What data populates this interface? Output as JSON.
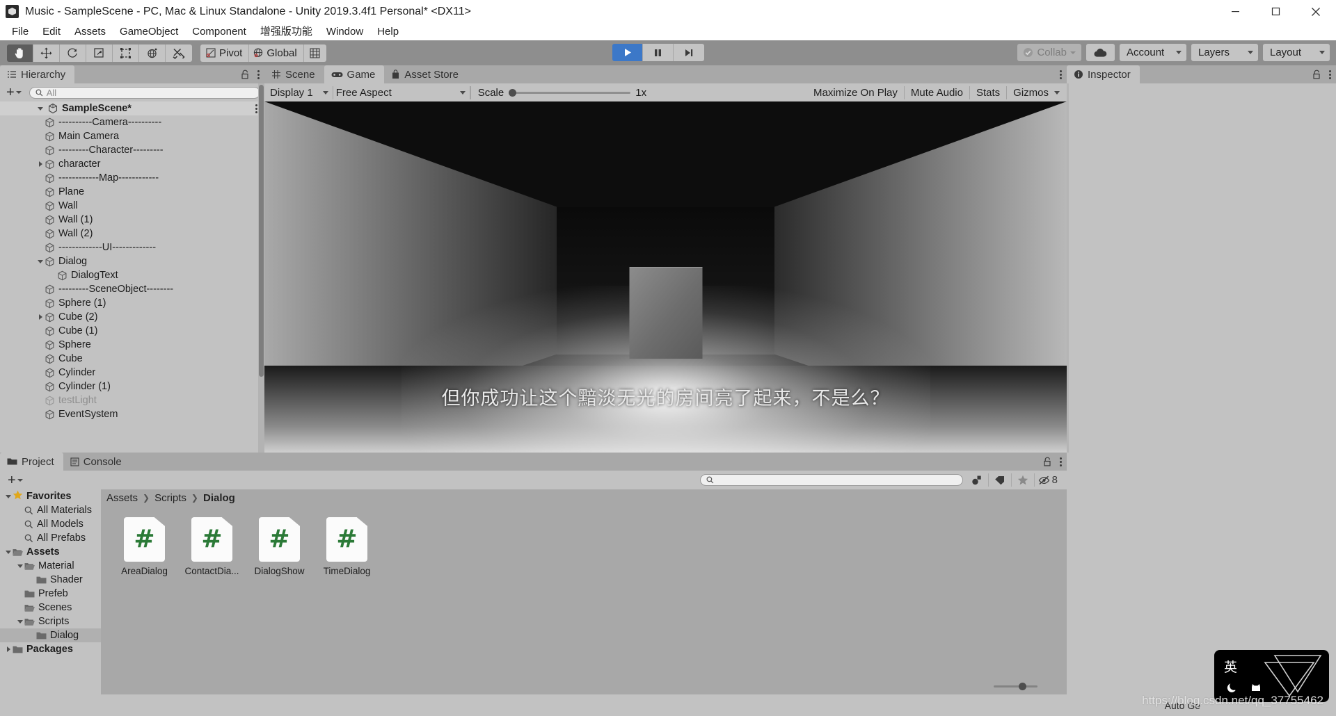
{
  "window": {
    "title": "Music - SampleScene - PC, Mac & Linux Standalone - Unity 2019.3.4f1 Personal* <DX11>",
    "logo_icon": "unity-logo-icon",
    "minimize_icon": "minimize-icon",
    "maximize_icon": "maximize-icon",
    "close_icon": "close-icon"
  },
  "menu": {
    "items": [
      {
        "label": "File"
      },
      {
        "label": "Edit"
      },
      {
        "label": "Assets"
      },
      {
        "label": "GameObject"
      },
      {
        "label": "Component"
      },
      {
        "label": "增强版功能"
      },
      {
        "label": "Window"
      },
      {
        "label": "Help"
      }
    ]
  },
  "toolbar": {
    "transform_tools": [
      {
        "name": "hand-tool",
        "icon": "hand-icon",
        "active": true
      },
      {
        "name": "move-tool",
        "icon": "move-arrows-icon",
        "active": false
      },
      {
        "name": "rotate-tool",
        "icon": "rotate-icon",
        "active": false
      },
      {
        "name": "scale-tool",
        "icon": "scale-icon",
        "active": false
      },
      {
        "name": "rect-tool",
        "icon": "rect-transform-icon",
        "active": false
      },
      {
        "name": "transform-tool",
        "icon": "combined-transform-icon",
        "active": false
      },
      {
        "name": "custom-tool",
        "icon": "wrench-screwdriver-icon",
        "active": false
      }
    ],
    "pivot_label": "Pivot",
    "pivot_icon": "pivot-icon",
    "global_label": "Global",
    "global_icon": "globe-icon",
    "grid_icon": "grid-snap-icon",
    "play_label": "play-icon",
    "pause_label": "pause-icon",
    "step_label": "step-icon",
    "play_active": true,
    "collab_label": "Collab",
    "collab_icon": "collab-check-icon",
    "cloud_icon": "cloud-icon",
    "account_label": "Account",
    "layers_label": "Layers",
    "layout_label": "Layout"
  },
  "hierarchy": {
    "tab_label": "Hierarchy",
    "tab_icon": "hierarchy-icon",
    "lock_icon": "lock-open-icon",
    "menu_icon": "kebab-menu-icon",
    "add_label": "+",
    "search_placeholder": "All",
    "search_icon": "search-icon",
    "search_value": "",
    "scene_name": "SampleScene*",
    "items": [
      {
        "label": "----------Camera----------",
        "depth": 1,
        "expand": "none",
        "dim": false
      },
      {
        "label": "Main Camera",
        "depth": 1,
        "expand": "none",
        "dim": false
      },
      {
        "label": "---------Character---------",
        "depth": 1,
        "expand": "none",
        "dim": false
      },
      {
        "label": "character",
        "depth": 1,
        "expand": "right",
        "dim": false
      },
      {
        "label": "------------Map------------",
        "depth": 1,
        "expand": "none",
        "dim": false
      },
      {
        "label": "Plane",
        "depth": 1,
        "expand": "none",
        "dim": false
      },
      {
        "label": "Wall",
        "depth": 1,
        "expand": "none",
        "dim": false
      },
      {
        "label": "Wall (1)",
        "depth": 1,
        "expand": "none",
        "dim": false
      },
      {
        "label": "Wall (2)",
        "depth": 1,
        "expand": "none",
        "dim": false
      },
      {
        "label": "-------------UI-------------",
        "depth": 1,
        "expand": "none",
        "dim": false
      },
      {
        "label": "Dialog",
        "depth": 1,
        "expand": "down",
        "dim": false
      },
      {
        "label": "DialogText",
        "depth": 2,
        "expand": "none",
        "dim": false
      },
      {
        "label": "---------SceneObject--------",
        "depth": 1,
        "expand": "none",
        "dim": false
      },
      {
        "label": "Sphere (1)",
        "depth": 1,
        "expand": "none",
        "dim": false
      },
      {
        "label": "Cube (2)",
        "depth": 1,
        "expand": "right",
        "dim": false
      },
      {
        "label": "Cube (1)",
        "depth": 1,
        "expand": "none",
        "dim": false
      },
      {
        "label": "Sphere",
        "depth": 1,
        "expand": "none",
        "dim": false
      },
      {
        "label": "Cube",
        "depth": 1,
        "expand": "none",
        "dim": false
      },
      {
        "label": "Cylinder",
        "depth": 1,
        "expand": "none",
        "dim": false
      },
      {
        "label": "Cylinder (1)",
        "depth": 1,
        "expand": "none",
        "dim": false
      },
      {
        "label": "testLight",
        "depth": 1,
        "expand": "none",
        "dim": true
      },
      {
        "label": "EventSystem",
        "depth": 1,
        "expand": "none",
        "dim": false
      }
    ]
  },
  "gameview": {
    "tabs": [
      {
        "label": "Scene",
        "icon": "scene-grid-icon",
        "selected": false
      },
      {
        "label": "Game",
        "icon": "gamepad-icon",
        "selected": true
      },
      {
        "label": "Asset Store",
        "icon": "shopping-bag-icon",
        "selected": false
      }
    ],
    "menu_icon": "kebab-menu-icon",
    "display_label": "Display 1",
    "aspect_label": "Free Aspect",
    "scale_label": "Scale",
    "scale_value": "1x",
    "maximize_label": "Maximize On Play",
    "mute_label": "Mute Audio",
    "stats_label": "Stats",
    "gizmos_label": "Gizmos",
    "dialog_text": "但你成功让这个黯淡无光的房间亮了起来，不是么？"
  },
  "inspector": {
    "tab_label": "Inspector",
    "tab_icon": "info-circle-icon",
    "lock_icon": "lock-open-icon",
    "menu_icon": "kebab-menu-icon"
  },
  "project": {
    "tabs": [
      {
        "label": "Project",
        "icon": "folder-icon",
        "selected": true
      },
      {
        "label": "Console",
        "icon": "console-lines-icon",
        "selected": false
      }
    ],
    "lock_icon": "lock-open-icon",
    "menu_icon": "kebab-menu-icon",
    "add_label": "+",
    "search_placeholder": "",
    "search_value": "",
    "search_icon": "search-icon",
    "filters": [
      {
        "name": "filter-by-type-icon",
        "label": ""
      },
      {
        "name": "filter-by-label-icon",
        "label": ""
      },
      {
        "name": "favorite-star-icon",
        "label": ""
      },
      {
        "name": "hidden-packages-icon",
        "label": "8"
      }
    ],
    "tree": [
      {
        "label": "Favorites",
        "depth": 0,
        "expand": "down",
        "icon": "star-icon",
        "bold": true,
        "selected": false
      },
      {
        "label": "All Materials",
        "depth": 1,
        "expand": "none",
        "icon": "search-icon",
        "bold": false,
        "selected": false
      },
      {
        "label": "All Models",
        "depth": 1,
        "expand": "none",
        "icon": "search-icon",
        "bold": false,
        "selected": false
      },
      {
        "label": "All Prefabs",
        "depth": 1,
        "expand": "none",
        "icon": "search-icon",
        "bold": false,
        "selected": false
      },
      {
        "label": "Assets",
        "depth": 0,
        "expand": "down",
        "icon": "folder-open-icon",
        "bold": true,
        "selected": false
      },
      {
        "label": "Material",
        "depth": 1,
        "expand": "down",
        "icon": "folder-open-icon",
        "bold": false,
        "selected": false
      },
      {
        "label": "Shader",
        "depth": 2,
        "expand": "none",
        "icon": "folder-icon",
        "bold": false,
        "selected": false
      },
      {
        "label": "Prefeb",
        "depth": 1,
        "expand": "none",
        "icon": "folder-icon",
        "bold": false,
        "selected": false
      },
      {
        "label": "Scenes",
        "depth": 1,
        "expand": "none",
        "icon": "folder-open-icon",
        "bold": false,
        "selected": false
      },
      {
        "label": "Scripts",
        "depth": 1,
        "expand": "down",
        "icon": "folder-open-icon",
        "bold": false,
        "selected": false
      },
      {
        "label": "Dialog",
        "depth": 2,
        "expand": "none",
        "icon": "folder-icon",
        "bold": false,
        "selected": true
      },
      {
        "label": "Packages",
        "depth": 0,
        "expand": "right",
        "icon": "folder-icon",
        "bold": true,
        "selected": false
      }
    ],
    "breadcrumb": [
      "Assets",
      "Scripts",
      "Dialog"
    ],
    "assets": [
      {
        "label": "AreaDialog",
        "icon": "csharp-script-icon"
      },
      {
        "label": "ContactDia...",
        "icon": "csharp-script-icon"
      },
      {
        "label": "DialogShow",
        "icon": "csharp-script-icon"
      },
      {
        "label": "TimeDialog",
        "icon": "csharp-script-icon"
      }
    ]
  },
  "statusbar": {
    "auto_generate_label": "Auto Ge"
  },
  "ime": {
    "mode_label": "英",
    "moon_icon": "moon-icon",
    "cat_icon": "cat-icon",
    "logo_icon": "triangle-logo-icon"
  },
  "watermark": {
    "text": "https://blog.csdn.net/qq_37755462"
  },
  "colors": {
    "accent_blue": "#3c78c8",
    "panel_bg": "#c2c2c2",
    "toolbar_bg": "#8e8e8e",
    "tabbar_bg": "#a8a8a8",
    "csharp_green": "#2b7a37",
    "star_gold": "#e0a71b"
  }
}
